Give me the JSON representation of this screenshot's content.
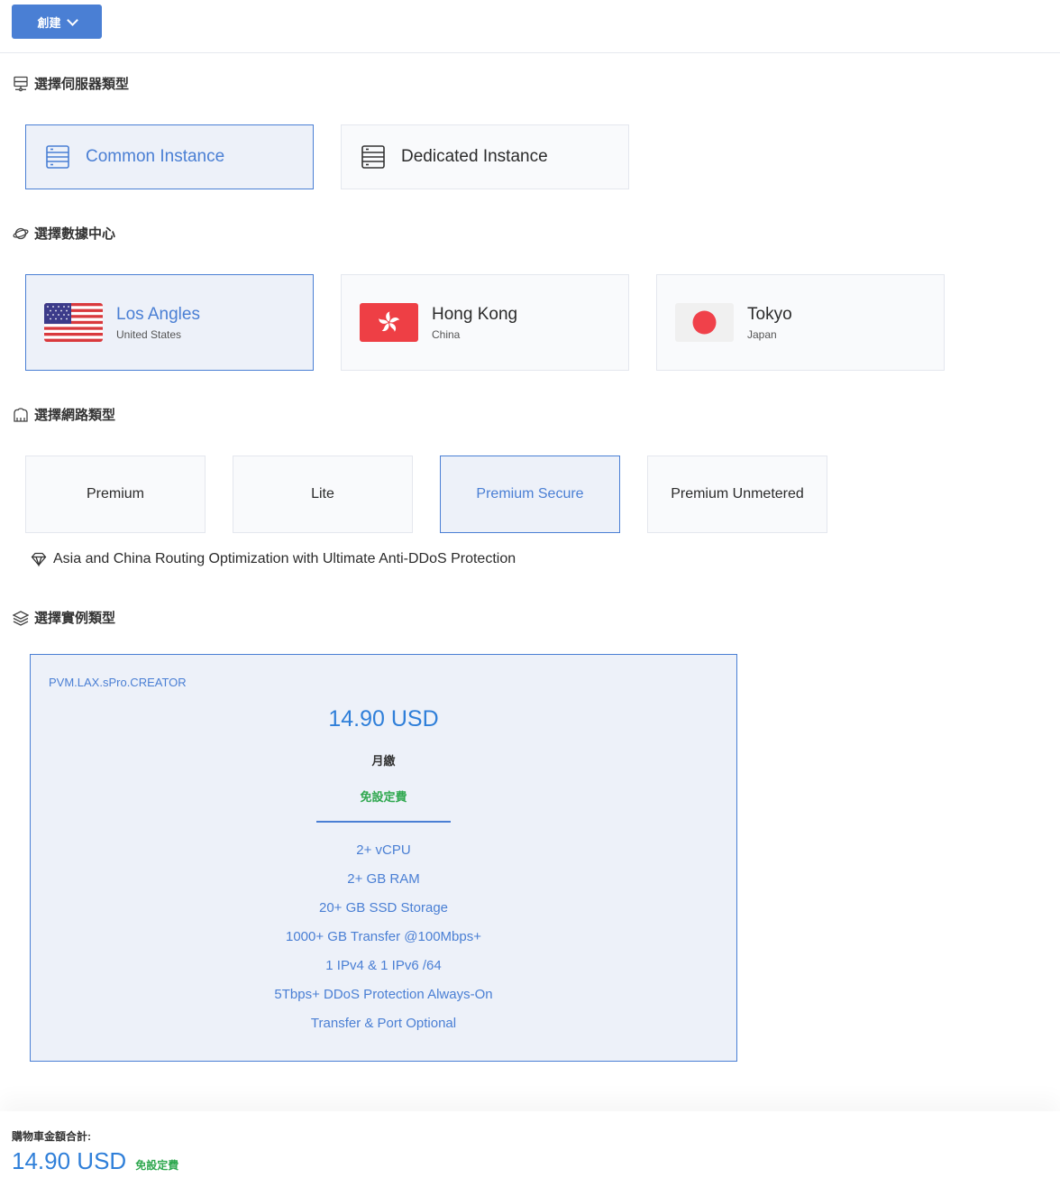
{
  "toolbar": {
    "create_label": "創建"
  },
  "sections": {
    "server_type": {
      "title": "選擇伺服器類型",
      "icon": "server-network-icon"
    },
    "datacenter": {
      "title": "選擇數據中心",
      "icon": "planet-icon"
    },
    "network": {
      "title": "選擇網路類型",
      "icon": "network-cloud-icon"
    },
    "instance": {
      "title": "選擇實例類型",
      "icon": "layers-icon"
    }
  },
  "server_types": [
    {
      "label": "Common Instance",
      "selected": true,
      "icon": "server-icon"
    },
    {
      "label": "Dedicated Instance",
      "selected": false,
      "icon": "server-icon"
    }
  ],
  "datacenters": [
    {
      "city": "Los Angles",
      "country": "United States",
      "flag": "us-flag-icon",
      "selected": true
    },
    {
      "city": "Hong Kong",
      "country": "China",
      "flag": "hk-flag-icon",
      "selected": false
    },
    {
      "city": "Tokyo",
      "country": "Japan",
      "flag": "jp-flag-icon",
      "selected": false
    }
  ],
  "networks": [
    {
      "label": "Premium",
      "selected": false
    },
    {
      "label": "Lite",
      "selected": false
    },
    {
      "label": "Premium Secure",
      "selected": true
    },
    {
      "label": "Premium Unmetered",
      "selected": false
    }
  ],
  "network_description": "Asia and China Routing Optimization with Ultimate Anti-DDoS Protection",
  "plan": {
    "name": "PVM.LAX.sPro.CREATOR",
    "price": "14.90 USD",
    "cycle": "月繳",
    "setup": "免設定費",
    "features": [
      "2+ vCPU",
      "2+ GB RAM",
      "20+ GB SSD Storage",
      "1000+ GB Transfer @100Mbps+",
      "1 IPv4 & 1 IPv6 /64",
      "5Tbps+ DDoS Protection Always-On",
      "Transfer & Port Optional"
    ]
  },
  "cart": {
    "label": "購物車金額合計:",
    "total": "14.90 USD",
    "setup": "免設定費"
  },
  "colors": {
    "accent": "#4a7fd4",
    "price": "#2f7fd9",
    "free": "#2fa84f",
    "selected_bg": "#edf1f9"
  }
}
